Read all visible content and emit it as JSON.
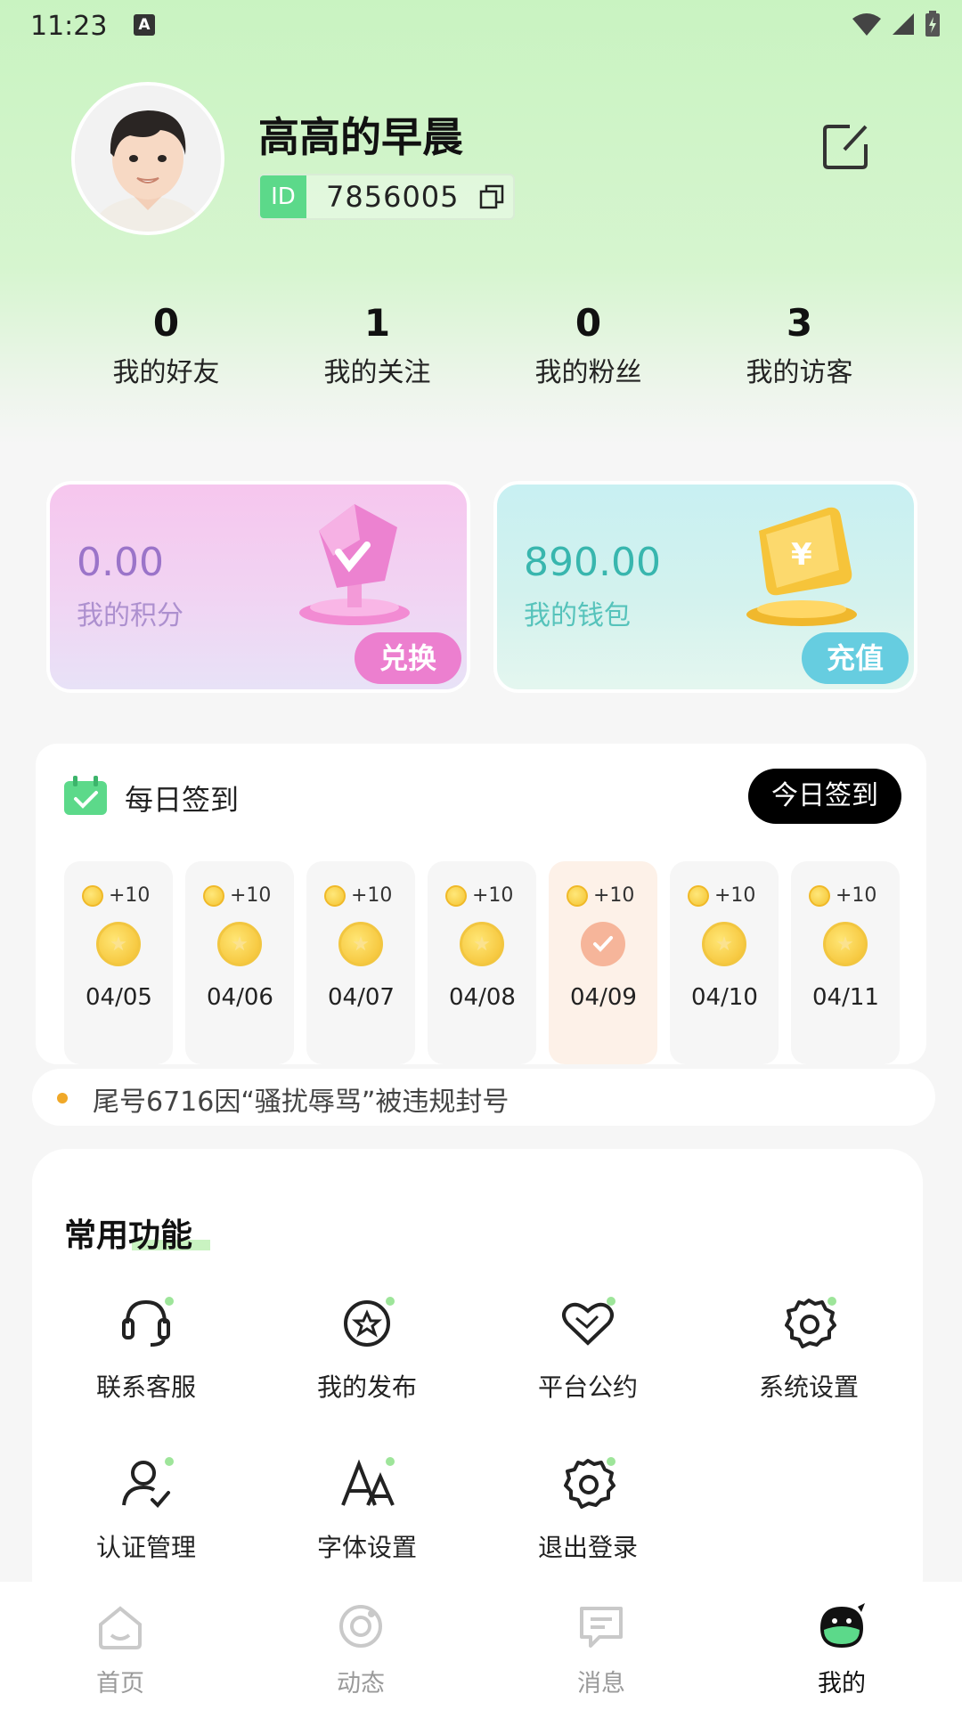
{
  "status_bar": {
    "time": "11:23",
    "notification_letter": "A"
  },
  "profile": {
    "name": "高高的早晨",
    "id_tag": "ID",
    "id_value": "7856005"
  },
  "stats": [
    {
      "value": "0",
      "label": "我的好友"
    },
    {
      "value": "1",
      "label": "我的关注"
    },
    {
      "value": "0",
      "label": "我的粉丝"
    },
    {
      "value": "3",
      "label": "我的访客"
    }
  ],
  "cards": {
    "points": {
      "value": "0.00",
      "label": "我的积分",
      "button": "兑换"
    },
    "wallet": {
      "value": "890.00",
      "label": "我的钱包",
      "button": "充值"
    }
  },
  "signin": {
    "title": "每日签到",
    "button": "今日签到",
    "days": [
      {
        "reward": "+10",
        "date": "04/05",
        "checked": false
      },
      {
        "reward": "+10",
        "date": "04/06",
        "checked": false
      },
      {
        "reward": "+10",
        "date": "04/07",
        "checked": false
      },
      {
        "reward": "+10",
        "date": "04/08",
        "checked": false
      },
      {
        "reward": "+10",
        "date": "04/09",
        "checked": true
      },
      {
        "reward": "+10",
        "date": "04/10",
        "checked": false
      },
      {
        "reward": "+10",
        "date": "04/11",
        "checked": false
      }
    ]
  },
  "notice": {
    "text": "尾号6716因“骚扰辱骂”被违规封号"
  },
  "functions": {
    "title": "常用功能",
    "items": [
      {
        "label": "联系客服",
        "icon": "headset-icon"
      },
      {
        "label": "我的发布",
        "icon": "star-circle-icon"
      },
      {
        "label": "平台公约",
        "icon": "handshake-heart-icon"
      },
      {
        "label": "系统设置",
        "icon": "gear-icon"
      },
      {
        "label": "认证管理",
        "icon": "user-check-icon"
      },
      {
        "label": "字体设置",
        "icon": "font-icon"
      },
      {
        "label": "退出登录",
        "icon": "gear-logout-icon"
      }
    ]
  },
  "nav": [
    {
      "label": "首页",
      "icon": "home-icon"
    },
    {
      "label": "动态",
      "icon": "moments-icon"
    },
    {
      "label": "消息",
      "icon": "message-icon"
    },
    {
      "label": "我的",
      "icon": "profile-mascot-icon",
      "active": true
    }
  ],
  "colors": {
    "header_green": "#c9f3c1",
    "id_tag": "#5cd98a",
    "points_button": "#ec7fcf",
    "wallet_button": "#66cde0",
    "wallet_value": "#38b6ae",
    "points_value": "#9b74c9"
  }
}
